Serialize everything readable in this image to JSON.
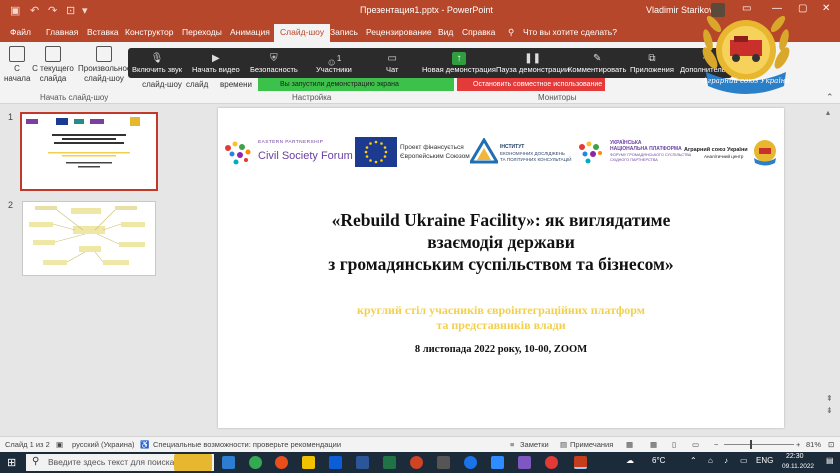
{
  "window": {
    "title": "Презентация1.pptx  -  PowerPoint",
    "user": "Vladimir Starikov"
  },
  "tabs": [
    "Файл",
    "Главная",
    "Вставка",
    "Конструктор",
    "Переходы",
    "Анимация",
    "Слайд-шоу",
    "Запись",
    "Рецензирование",
    "Вид",
    "Справка",
    "Что вы хотите сделать?"
  ],
  "ribbon": {
    "from_start": "С начала",
    "from_current": "С текущего слайда",
    "custom": "Произвольное слайд-шоу",
    "show_setup": "слайд-шоу",
    "hide_slide": "слайд",
    "rehearse": "времени",
    "group_start": "Начать слайд-шоу",
    "group_setup": "Настройка",
    "group_monitors": "Мониторы"
  },
  "presenter_bar": {
    "items": [
      "Включить звук",
      "Начать видео",
      "Безопасность",
      "Участники",
      "Чат",
      "Новая демонстрация",
      "Пауза демонстрации",
      "Комментировать",
      "Приложения",
      "Дополнительно"
    ],
    "participants_count": "1",
    "sharing_notice": "Вы запустили демонстрацию экрана",
    "stop_sharing": "Остановить совместное использование"
  },
  "badge": {
    "text": "Аграрний союз України",
    "colors": {
      "gold": "#e8b730",
      "blue": "#2a7fc9",
      "wheat": "#d9a72a"
    }
  },
  "thumbnails": {
    "numbers": [
      "1",
      "2"
    ]
  },
  "slide": {
    "logos": {
      "eap_top": "EASTERN PARTNERSHIP",
      "csf": "Civil Society Forum",
      "eu_line1": "Проект фінансується",
      "eu_line2": "Європейським Союзом",
      "inst_line1": "ІНСТИТУТ",
      "inst_line2": "ЕКОНОМІЧНИХ ДОСЛІДЖЕНЬ",
      "inst_line3": "ТА ПОЛІТИЧНИХ КОНСУЛЬТАЦІЙ",
      "unp_line1": "УКРАЇНСЬКА",
      "unp_line2": "НАЦІОНАЛЬНА ПЛАТФОРМА",
      "unp_line3": "ФОРУМУ ГРОМАДЯНСЬКОГО СУСПІЛЬСТВА",
      "unp_line4": "СХІДНОГО ПАРТНЕРСТВА",
      "asu_line1": "Аграрний союз України",
      "asu_line2": "Аналітичний центр"
    },
    "title_line1": "«Rebuild Ukraine Facility»: як виглядатиме",
    "title_line2": "взаємодія держави",
    "title_line3": "з громадянським суспільством та бізнесом»",
    "sub_line1": "круглий стіл учасників євроінтеграційних платформ",
    "sub_line2": "та представників влади",
    "date": "8 листопада 2022 року, 10-00, ZOOM"
  },
  "status": {
    "slide_of": "Слайд 1 из 2",
    "language": "русский (Украина)",
    "accessibility": "Специальные возможности: проверьте рекомендации",
    "notes": "Заметки",
    "comments": "Примечания",
    "zoom": "81%"
  },
  "taskbar": {
    "search_placeholder": "Введите здесь текст для поиска",
    "temp": "6°C",
    "lang": "ENG",
    "time": "22:30",
    "date": "09.11.2022"
  }
}
